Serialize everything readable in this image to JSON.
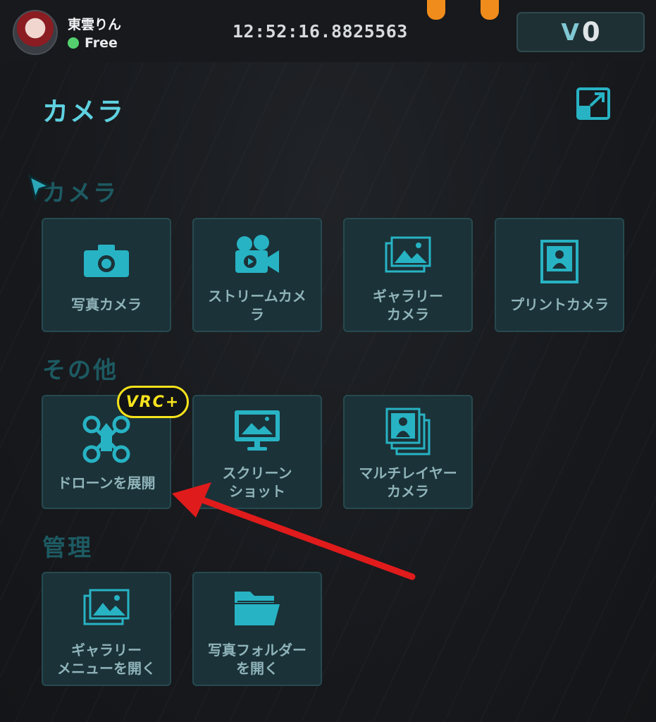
{
  "user": {
    "name": "東雲りん",
    "status": "Free",
    "status_color": "#54d16e"
  },
  "clock": "12:52:16.8825563",
  "currency": {
    "icon": "V-logo-icon",
    "value": "0"
  },
  "page": {
    "title": "カメラ"
  },
  "sections": [
    {
      "title": "カメラ",
      "tiles": [
        {
          "label": "写真カメラ",
          "icon": "camera-icon"
        },
        {
          "label": "ストリームカメ\nラ",
          "icon": "video-camera-icon"
        },
        {
          "label": "ギャラリー\nカメラ",
          "icon": "gallery-icon"
        },
        {
          "label": "プリントカメラ",
          "icon": "print-portrait-icon"
        }
      ]
    },
    {
      "title": "その他",
      "tiles": [
        {
          "label": "ドローンを展開",
          "icon": "drone-icon",
          "badge": "VRC+"
        },
        {
          "label": "スクリーン\nショット",
          "icon": "screenshot-monitor-icon"
        },
        {
          "label": "マルチレイヤー\nカメラ",
          "icon": "multilayer-portrait-icon"
        }
      ]
    },
    {
      "title": "管理",
      "tiles": [
        {
          "label": "ギャラリー\nメニューを開く",
          "icon": "gallery-icon"
        },
        {
          "label": "写真フォルダー\nを開く",
          "icon": "folder-icon"
        }
      ]
    }
  ],
  "colors": {
    "accent": "#5fd1e0",
    "tile_bg": "#1b3238",
    "icon": "#27b3c4",
    "badge": "#f5e21b",
    "annotation_arrow": "#e01b1b"
  }
}
